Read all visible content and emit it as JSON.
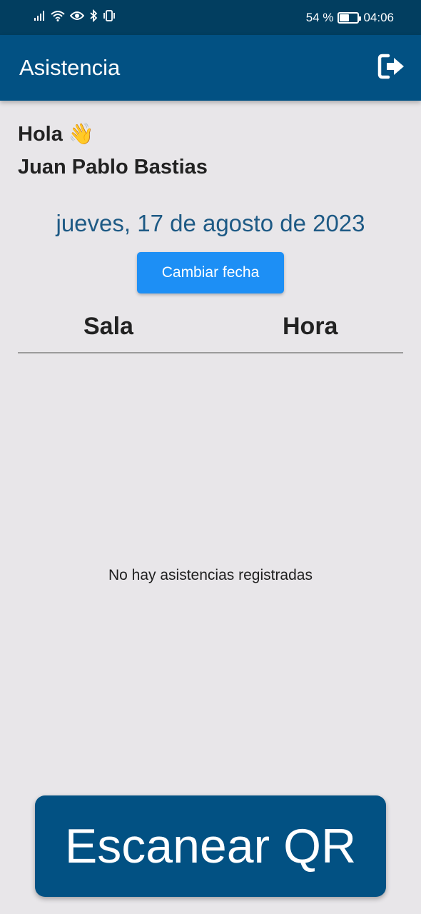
{
  "status_bar": {
    "battery_percent": "54 %",
    "battery_level": 0.54,
    "time": "04:06",
    "icons": [
      "signal-icon",
      "wifi-icon",
      "eye-icon",
      "bluetooth-icon",
      "vibrate-icon",
      "battery-icon"
    ]
  },
  "app_bar": {
    "title": "Asistencia",
    "logout_icon": "logout-icon"
  },
  "greeting": {
    "hello": "Hola",
    "emoji": "👋",
    "name": "Juan Pablo Bastias"
  },
  "date": {
    "value": "jueves, 17 de agosto de 2023",
    "change_button": "Cambiar fecha"
  },
  "table": {
    "columns": [
      "Sala",
      "Hora"
    ],
    "empty_message": "No hay asistencias registradas"
  },
  "scan_button": {
    "label": "Escanear QR"
  },
  "colors": {
    "status_bar": "#023e60",
    "app_bar": "#025183",
    "background": "#e8e6e9",
    "date_text": "#1e5a85",
    "change_date_button": "#1d8ff5",
    "scan_button": "#025183"
  }
}
